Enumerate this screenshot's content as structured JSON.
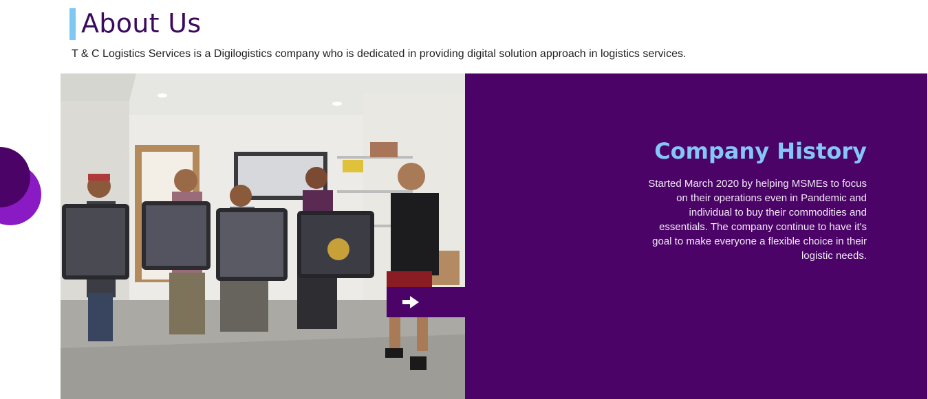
{
  "about": {
    "title": "About Us",
    "description": "T & C Logistics Services is a Digilogistics company who is dedicated in providing digital solution approach in logistics services."
  },
  "history": {
    "title": "Company History",
    "text": "Started March 2020 by helping MSMEs to focus on their operations even in Pandemic and individual to buy their commodities and essentials. The company continue to have it's goal to make everyone a flexible choice in their logistic needs."
  },
  "controls": {
    "next_icon": "arrow-right-icon"
  },
  "colors": {
    "brand_purple": "#4c0367",
    "accent_purple": "#8a1bc4",
    "accent_blue": "#7ec8f4",
    "history_title": "#86c6f6"
  }
}
